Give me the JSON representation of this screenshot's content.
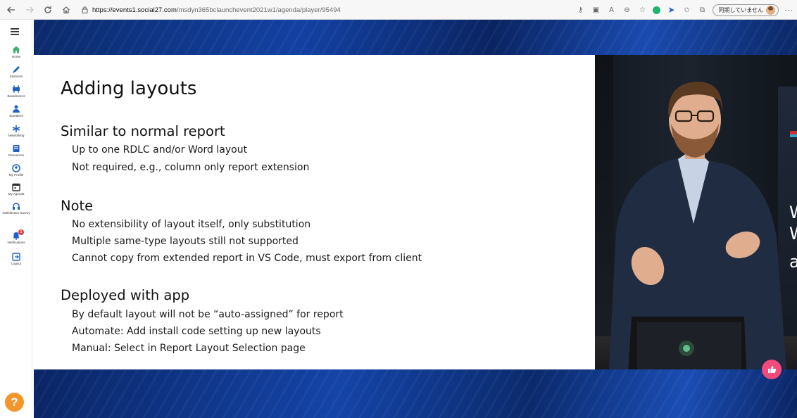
{
  "browser": {
    "url_domain": "https://events1.social27.com",
    "url_path": "/msdyn365bclaunchevent2021w1/agenda/player/95494",
    "sync_label": "同期していません",
    "more_label": "···"
  },
  "sidebar": {
    "items": [
      {
        "label": "Home",
        "icon": "home-icon",
        "color": "#3fae6f"
      },
      {
        "label": "Sessions",
        "icon": "sessions-icon",
        "color": "#1e5fc9"
      },
      {
        "label": "Boardrooms",
        "icon": "boardrooms-icon",
        "color": "#1e5fc9"
      },
      {
        "label": "Speakers",
        "icon": "speakers-icon",
        "color": "#1e5fc9"
      },
      {
        "label": "Networking",
        "icon": "networking-icon",
        "color": "#1e5fc9"
      },
      {
        "label": "Resources",
        "icon": "resources-icon",
        "color": "#1e5fc9"
      },
      {
        "label": "My Profile",
        "icon": "profile-icon",
        "color": "#1e5fc9"
      },
      {
        "label": "My Agenda",
        "icon": "agenda-icon",
        "color": "#1e5fc9"
      },
      {
        "label": "Satisfaction Survey",
        "icon": "survey-icon",
        "color": "#1e5fc9"
      },
      {
        "label": "Notifications",
        "icon": "notifications-icon",
        "color": "#1e5fc9",
        "badge": "1"
      },
      {
        "label": "Logout",
        "icon": "logout-icon",
        "color": "#1e5fc9"
      }
    ],
    "help_label": "?"
  },
  "slide": {
    "title": "Adding layouts",
    "sections": [
      {
        "heading": "Similar to normal report",
        "bullets": [
          "Up to one RDLC and/or Word layout",
          "Not required, e.g., column only report extension"
        ]
      },
      {
        "heading": "Note",
        "bullets": [
          "No extensibility of layout itself, only substitution",
          "Multiple same-type layouts still not supported",
          "Cannot copy from extended report in VS Code, must export from client"
        ]
      },
      {
        "heading": "Deployed with app",
        "bullets": [
          "By default layout will not be “auto-assigned” for report",
          "Automate: Add install code setting up new layouts",
          "Manual: Select in Report Layout Selection page"
        ]
      }
    ]
  },
  "video": {
    "backdrop_text": "W\nW\na"
  }
}
